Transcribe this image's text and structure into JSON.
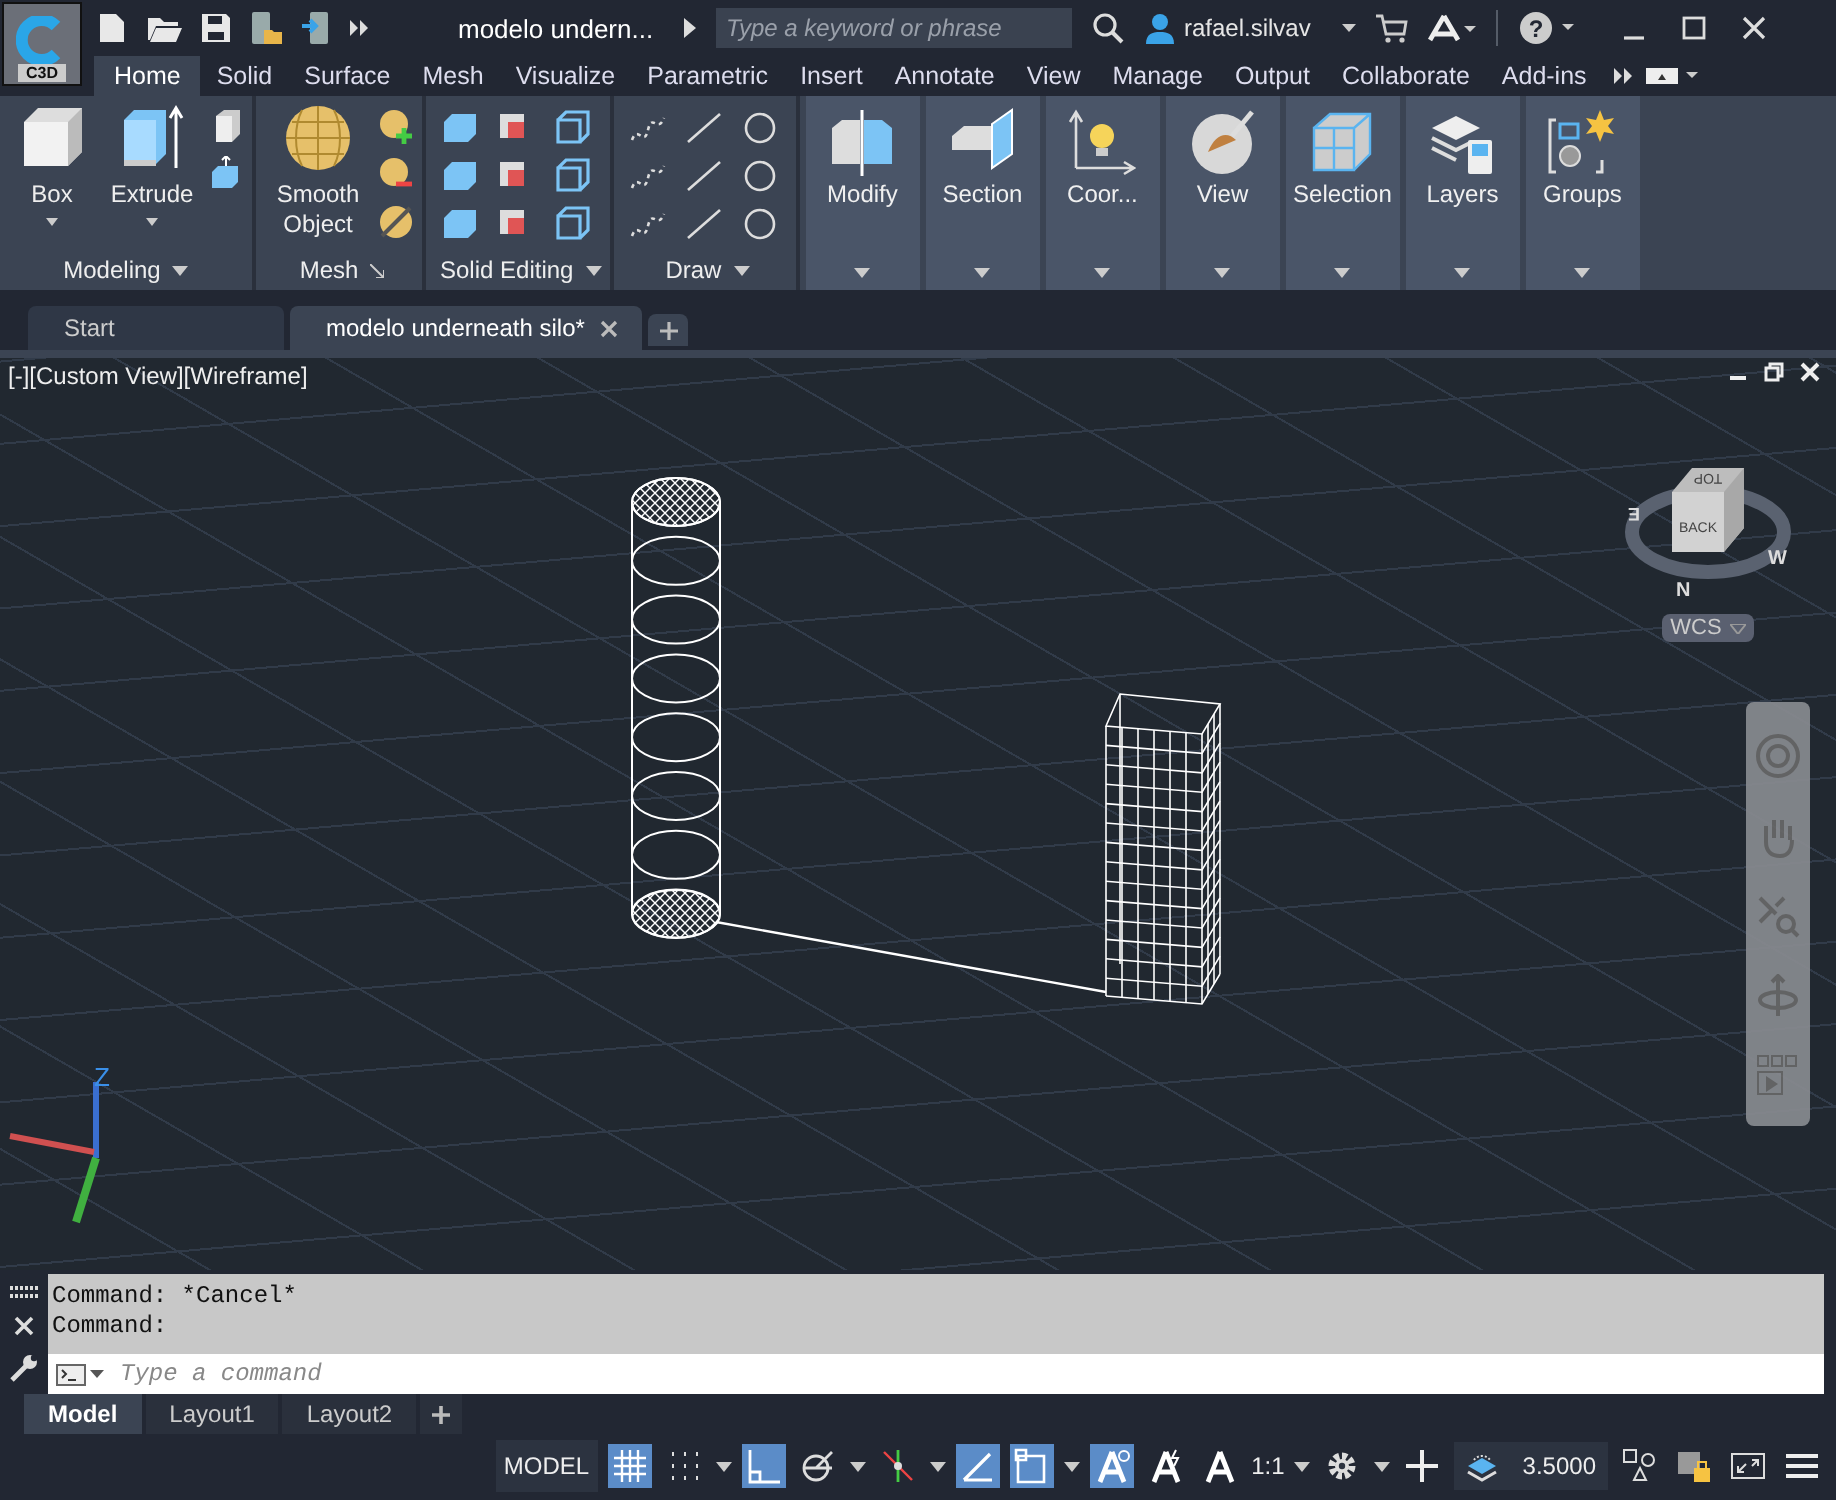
{
  "title_bar": {
    "app_badge": "C3D",
    "document_title": "modelo undern...",
    "search": {
      "placeholder": "Type a keyword or phrase"
    },
    "user": "rafael.silvav",
    "help": "?"
  },
  "ribbon_tabs": [
    {
      "label": "Home",
      "selected": true
    },
    {
      "label": "Solid",
      "selected": false
    },
    {
      "label": "Surface",
      "selected": false
    },
    {
      "label": "Mesh",
      "selected": false
    },
    {
      "label": "Visualize",
      "selected": false
    },
    {
      "label": "Parametric",
      "selected": false
    },
    {
      "label": "Insert",
      "selected": false
    },
    {
      "label": "Annotate",
      "selected": false
    },
    {
      "label": "View",
      "selected": false
    },
    {
      "label": "Manage",
      "selected": false
    },
    {
      "label": "Output",
      "selected": false
    },
    {
      "label": "Collaborate",
      "selected": false
    },
    {
      "label": "Add-ins",
      "selected": false
    }
  ],
  "ribbon_panels": [
    {
      "kind": "modeling",
      "label": "Modeling",
      "tools": [
        "Box",
        "Extrude"
      ]
    },
    {
      "kind": "mesh",
      "label": "Mesh",
      "tools": [
        "Smooth Object"
      ]
    },
    {
      "kind": "solid_editing",
      "label": "Solid Editing"
    },
    {
      "kind": "draw",
      "label": "Draw"
    },
    {
      "kind": "modify",
      "label": "Modify"
    },
    {
      "kind": "section",
      "label": "Section"
    },
    {
      "kind": "coordinates",
      "label": "Coor..."
    },
    {
      "kind": "view",
      "label": "View"
    },
    {
      "kind": "selection",
      "label": "Selection"
    },
    {
      "kind": "layers",
      "label": "Layers"
    },
    {
      "kind": "groups",
      "label": "Groups"
    }
  ],
  "document_tabs": [
    {
      "label": "Start",
      "selected": false
    },
    {
      "label": "modelo underneath silo*",
      "selected": true
    }
  ],
  "viewport": {
    "label": "[-][Custom View][Wireframe]",
    "view_cube": {
      "top": "TOP",
      "side": "BACK",
      "compass": [
        "E",
        "W",
        "N"
      ]
    },
    "coordinate_system": "WCS",
    "axis_label": "Z"
  },
  "command_line": {
    "history": [
      "Command: *Cancel*",
      "Command:"
    ],
    "placeholder": "Type a command"
  },
  "layout_tabs": [
    {
      "label": "Model",
      "selected": true
    },
    {
      "label": "Layout1",
      "selected": false
    },
    {
      "label": "Layout2",
      "selected": false
    }
  ],
  "status_bar": [
    {
      "kind": "label",
      "text": "MODEL"
    },
    {
      "kind": "grid",
      "on": true
    },
    {
      "kind": "snap",
      "on": false
    },
    {
      "kind": "ortho",
      "on": true
    },
    {
      "kind": "polar",
      "on": false
    },
    {
      "kind": "tracking",
      "on": false
    },
    {
      "kind": "lineweight",
      "on": true
    },
    {
      "kind": "ucs",
      "on": true
    },
    {
      "kind": "annotation",
      "on": true
    },
    {
      "kind": "autoscale",
      "on": false
    },
    {
      "kind": "annoscale",
      "on": false
    },
    {
      "kind": "scale",
      "text": "1:1"
    },
    {
      "kind": "gear"
    },
    {
      "kind": "plus"
    },
    {
      "kind": "elevation",
      "text": "3.5000"
    },
    {
      "kind": "isolate"
    },
    {
      "kind": "lock"
    },
    {
      "kind": "fullscreen"
    },
    {
      "kind": "menu"
    }
  ]
}
